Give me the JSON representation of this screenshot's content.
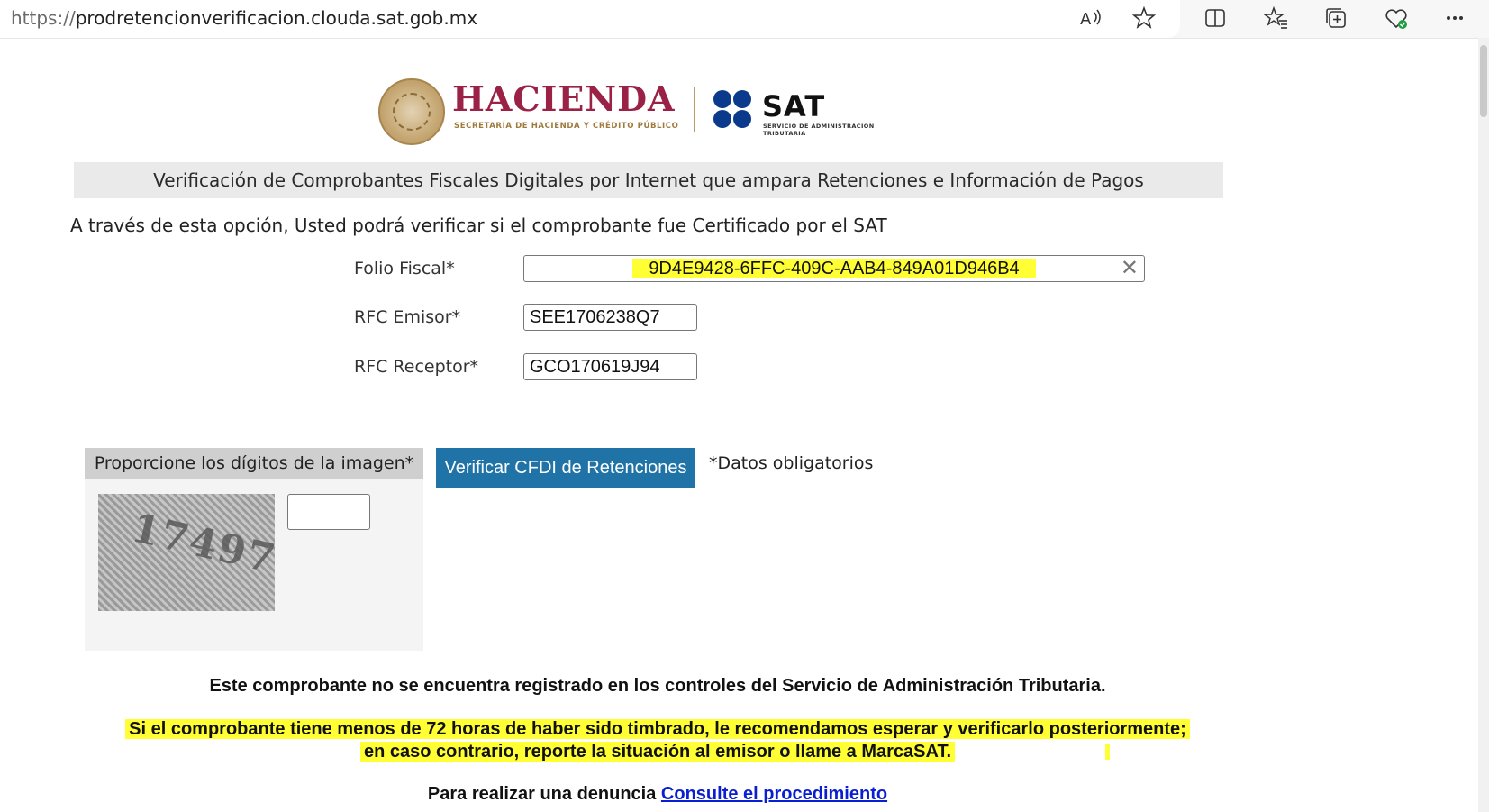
{
  "browser": {
    "url_scheme": "https://",
    "url_host": "prodretencionverificacion.clouda.sat.gob.mx",
    "icons": [
      "read-aloud-icon",
      "favorite-star-icon",
      "split-screen-icon",
      "favorites-icon",
      "collections-icon",
      "browser-essentials-icon",
      "more-icon"
    ]
  },
  "header": {
    "hacienda_title": "HACIENDA",
    "hacienda_subtitle": "SECRETARÍA DE HACIENDA Y CRÉDITO PÚBLICO",
    "sat_title": "SAT",
    "sat_subtitle": "SERVICIO DE ADMINISTRACIÓN TRIBUTARIA",
    "seal_icon": "mexico-seal-icon"
  },
  "banner": "Verificación de Comprobantes Fiscales Digitales por Internet que ampara Retenciones e Información de Pagos",
  "intro": "A través de esta opción, Usted podrá verificar si el comprobante fue Certificado por el SAT",
  "form": {
    "folio_label": "Folio Fiscal*",
    "folio_value": "9D4E9428-6FFC-409C-AAB4-849A01D946B4",
    "rfc_emisor_label": "RFC Emisor*",
    "rfc_emisor_value": "SEE1706238Q7",
    "rfc_receptor_label": "RFC Receptor*",
    "rfc_receptor_value": "GCO170619J94",
    "clear_icon": "clear-x-icon"
  },
  "captcha": {
    "heading": "Proporcione los dígitos de la imagen*",
    "image_digits": "17497",
    "input_value": ""
  },
  "actions": {
    "verify_button": "Verificar CFDI de Retenciones",
    "required_note": "*Datos obligatorios"
  },
  "result": {
    "not_registered": "Este comprobante no se encuentra registrado en los controles del Servicio de Administración Tributaria.",
    "advice_line1": "Si el comprobante tiene menos de 72 horas de haber sido timbrado, le recomendamos esperar y verificarlo posteriormente;",
    "advice_line2": "en caso contrario, reporte la situación al emisor o llame a MarcaSAT.",
    "complaint_prefix": "Para realizar una denuncia",
    "complaint_link": "Consulte el procedimiento"
  },
  "colors": {
    "hacienda": "#9b2247",
    "sat_blue": "#0b3a8c",
    "button": "#1f73a7",
    "highlight": "#ffff33",
    "link": "#0a1fd1"
  }
}
